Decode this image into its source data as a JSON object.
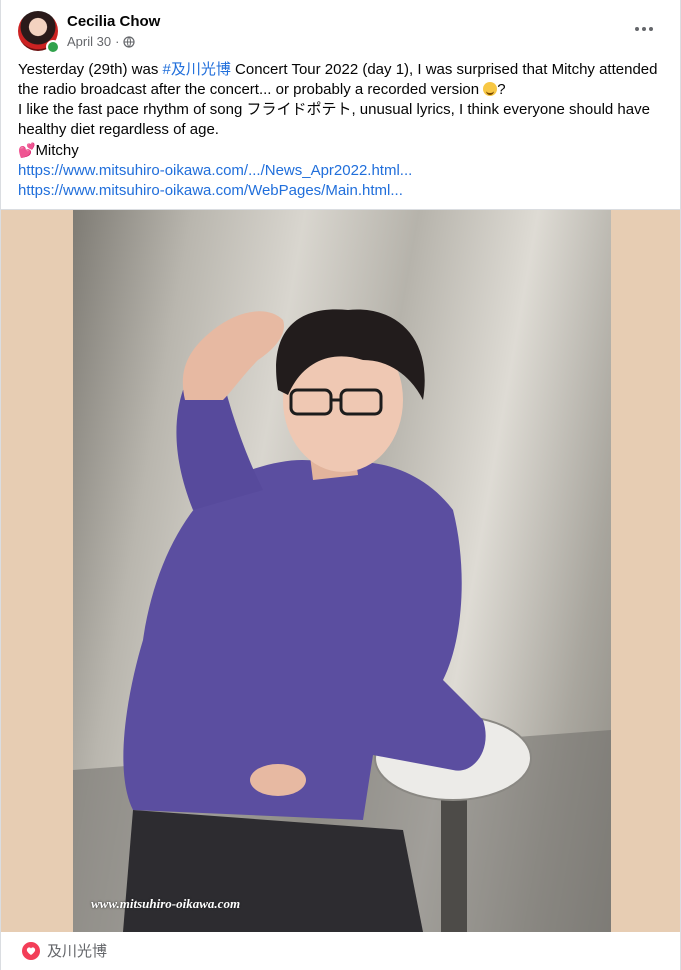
{
  "post": {
    "author": "Cecilia Chow",
    "date": "April 30",
    "text": {
      "line1_prefix": "Yesterday (29th) was ",
      "hashtag": "#及川光博",
      "line1_suffix": " Concert Tour 2022 (day 1), I was surprised that Mitchy attended the radio broadcast after the concert... or probably a recorded version ",
      "line1_end": "?",
      "line2": "I like the fast pace rhythm of song フライドポテト, unusual lyrics, I think everyone should have healthy diet regardless of age.",
      "line3_emoji": "💕",
      "line3": "Mitchy",
      "link1": "https://www.mitsuhiro-oikawa.com/.../News_Apr2022.html...",
      "link2": "https://www.mitsuhiro-oikawa.com/WebPages/Main.html..."
    },
    "photo": {
      "watermark": "www.mitsuhiro-oikawa.com"
    },
    "reactions": {
      "icon": "love-icon",
      "names": "及川光博"
    }
  },
  "colors": {
    "link": "#216fdb",
    "love": "#f33e58",
    "shirt": "#5b4ea0",
    "backdrop": "#e7cdb3"
  }
}
